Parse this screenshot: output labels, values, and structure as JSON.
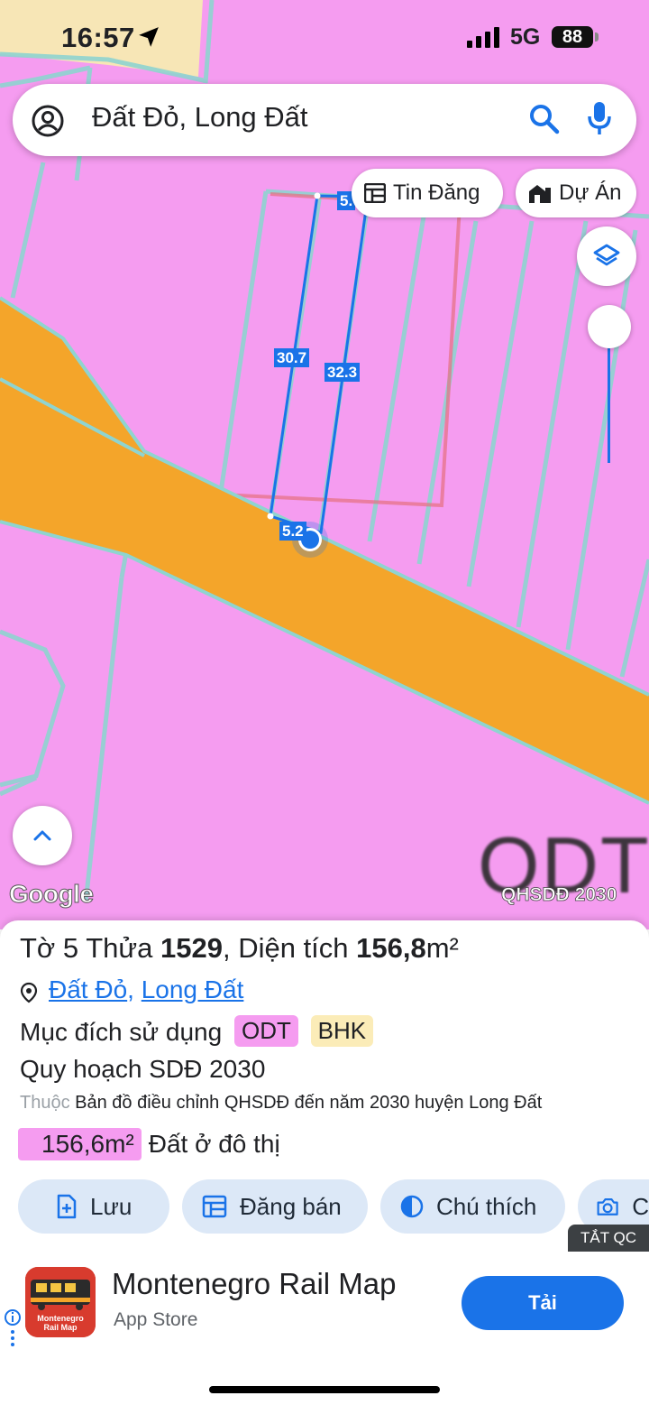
{
  "status_bar": {
    "time": "16:57",
    "network": "5G",
    "battery": "88"
  },
  "search": {
    "query": "Đất Đỏ, Long Đất"
  },
  "map_chips": {
    "listings": "Tin Đăng",
    "projects": "Dự Án"
  },
  "measurements": {
    "left_side": "30.7",
    "right_side": "32.3",
    "bottom_side": "5.2",
    "top_side": "5."
  },
  "map": {
    "zone_code": "ODT",
    "attribution": "Google",
    "plan_label": "QHSDĐ 2030"
  },
  "parcel": {
    "title_prefix": "Tờ",
    "sheet_no": "5",
    "parcel_word": "Thửa",
    "parcel_no": "1529",
    "area_word": ", Diện tích",
    "area_value": "156,8",
    "area_unit": "m²",
    "district": "Đất Đỏ",
    "commune": "Long Đất",
    "purpose_label": "Mục đích sử dụng",
    "purpose_tags": [
      "ODT",
      "BHK"
    ],
    "plan_title": "Quy hoạch SDĐ 2030",
    "belongs_label": "Thuộc",
    "belongs_value": "Bản đồ điều chỉnh QHSDĐ đến năm 2030 huyện Long Đất",
    "plan_area": "156,6m²",
    "plan_area_type": "Đất ở đô thị"
  },
  "actions": [
    {
      "label": "Lưu",
      "icon": "save-plus-icon"
    },
    {
      "label": "Đăng bán",
      "icon": "listing-icon"
    },
    {
      "label": "Chú thích",
      "icon": "legend-icon"
    },
    {
      "label": "C",
      "icon": "camera-icon"
    }
  ],
  "ad_off": "TẮT QC",
  "ad": {
    "app_name": "Montenegro Rail Map",
    "store": "App Store",
    "button": "Tải",
    "icon_text": "Montenegro Rail Map"
  },
  "colors": {
    "residential_zone": "#f59cf0",
    "road_zone": "#f4a52a",
    "accent": "#1a73e8",
    "tag_odt": "#f59cf0",
    "tag_bhk": "#fbecb8"
  }
}
